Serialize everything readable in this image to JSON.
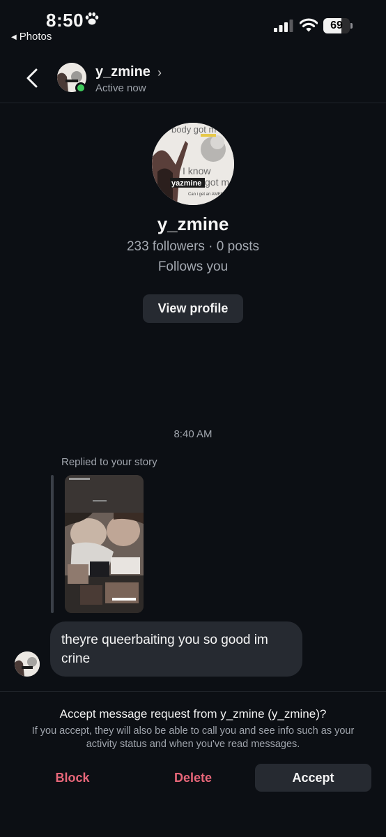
{
  "status_bar": {
    "time": "8:50",
    "back_app": "Photos",
    "battery_level": 69,
    "battery_text": "69",
    "icons": [
      "paw-icon",
      "signal-icon",
      "wifi-icon",
      "battery-icon"
    ]
  },
  "header": {
    "username": "y_zmine",
    "status": "Active now",
    "chevron": "›",
    "online_color": "#3fc95b",
    "icons": [
      "back-chevron-icon",
      "profile-chevron-icon"
    ]
  },
  "profile": {
    "username": "y_zmine",
    "stats": "233 followers · 0 posts",
    "follows": "Follows you",
    "view_profile_label": "View profile",
    "avatar_text": {
      "line1": "body got m",
      "line2": "I know",
      "line3": "yazmine",
      "line4": "got m",
      "line5": "Can i get an AMEN"
    }
  },
  "thread": {
    "timestamp": "8:40 AM",
    "reply_label": "Replied to your story",
    "message": "theyre queerbaiting you so good im crine"
  },
  "request": {
    "title": "Accept message request from y_zmine (y_zmine)?",
    "info": "If you accept, they will also be able to call you and see info such as your activity status and when you've read messages.",
    "block_label": "Block",
    "delete_label": "Delete",
    "accept_label": "Accept",
    "danger_color": "#e8677a"
  }
}
